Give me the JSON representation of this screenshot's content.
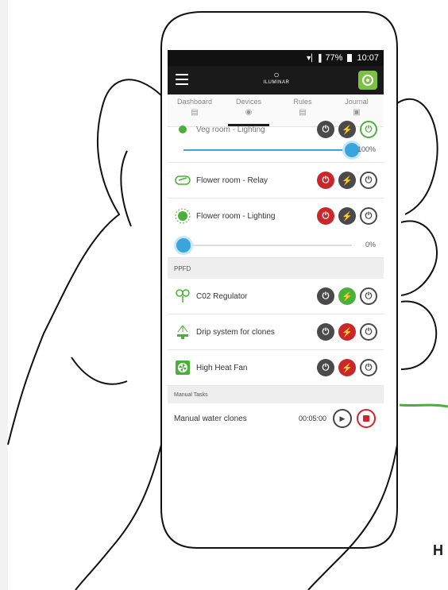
{
  "status": {
    "signal": "▼▏▐",
    "battery": "77%",
    "time": "10:07"
  },
  "app": {
    "logo_text": "ILUMINAR"
  },
  "tabs": [
    {
      "label": "Dashboard",
      "icon": "dashboard-icon"
    },
    {
      "label": "Devices",
      "icon": "devices-icon",
      "active": true
    },
    {
      "label": "Rules",
      "icon": "rules-icon"
    },
    {
      "label": "Journal",
      "icon": "journal-icon"
    }
  ],
  "devices": [
    {
      "name": "Veg room - Lighting",
      "slider_value": 1.0,
      "slider_label": "100%"
    },
    {
      "name": "Flower room - Relay"
    },
    {
      "name": "Flower room - Lighting",
      "slider_value": 0.0,
      "slider_label": "0%"
    }
  ],
  "sections": {
    "ppfd": "PPFD",
    "manual_tasks": "Manual Tasks"
  },
  "ppfd_devices": [
    {
      "name": "C02 Regulator"
    },
    {
      "name": "Drip system for clones"
    },
    {
      "name": "High Heat Fan"
    }
  ],
  "task": {
    "name": "Manual water clones",
    "time": "00:05:00"
  },
  "brand_fragment": "H",
  "colors": {
    "accent_green": "#7cc242",
    "red": "#c8272c",
    "blue": "#3aa4dd"
  }
}
